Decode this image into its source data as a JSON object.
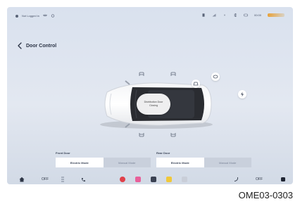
{
  "status_bar": {
    "login": "Not Logged in",
    "time": "00:00"
  },
  "header": {
    "title": "Door Control"
  },
  "car_status": {
    "line1": "Distribution Door",
    "line2": "Closing"
  },
  "front_door": {
    "label": "Front Door",
    "options": [
      "Electric Mode",
      "Manual Mode"
    ],
    "selected": "Electric Mode"
  },
  "rear_door": {
    "label": "Rear Door",
    "options": [
      "Electric Mode",
      "Manual Mode"
    ],
    "selected": "Electric Mode"
  },
  "dock": {
    "left_temp": "OFF",
    "right_temp": "OFF"
  },
  "figure_code": "OME03-0303",
  "colors": {
    "screen_bg": "#dfe5ef",
    "selected_segment": "#ffffff",
    "unselected_segment": "#c9d0dc",
    "brand_accent": "#e8a23a"
  },
  "icons": [
    "home-icon",
    "seat-heat-icon",
    "phone-icon",
    "app-red-icon",
    "app-pink-icon",
    "app-dark-icon",
    "app-yellow-icon",
    "app-grey-icon",
    "steering-heat-icon",
    "power-icon",
    "door-icon",
    "trunk-icon",
    "charge-port-icon"
  ]
}
